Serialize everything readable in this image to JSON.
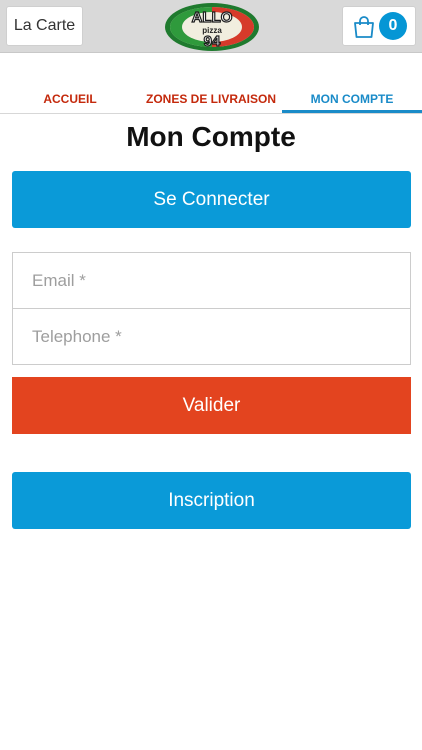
{
  "header": {
    "menu_label": "La Carte",
    "logo_text": "ALLO pizza 94",
    "cart_count": "0"
  },
  "tabs": [
    {
      "label": "ACCUEIL",
      "active": false
    },
    {
      "label": "ZONES DE LIVRAISON",
      "active": false
    },
    {
      "label": "MON COMPTE",
      "active": true
    }
  ],
  "page": {
    "title": "Mon Compte",
    "connect_label": "Se Connecter",
    "email_placeholder": "Email *",
    "phone_placeholder": "Telephone *",
    "submit_label": "Valider",
    "signup_label": "Inscription"
  },
  "colors": {
    "accent_blue": "#0a9ad8",
    "submit_red": "#e3441f",
    "tab_red": "#c4290c",
    "tab_active_blue": "#1a8bc8"
  }
}
